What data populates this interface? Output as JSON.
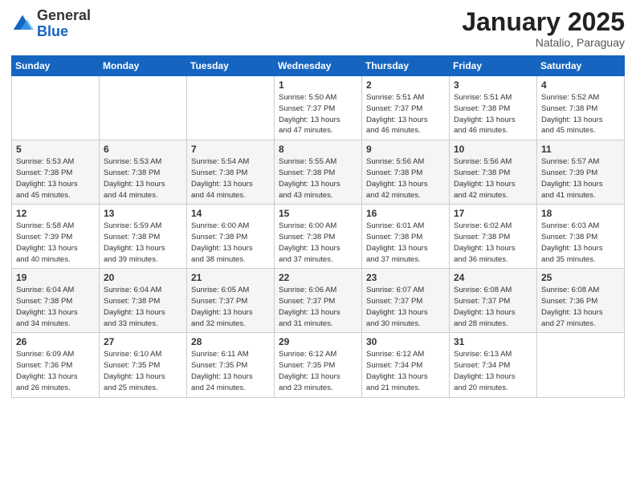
{
  "logo": {
    "general": "General",
    "blue": "Blue"
  },
  "header": {
    "month": "January 2025",
    "location": "Natalio, Paraguay"
  },
  "weekdays": [
    "Sunday",
    "Monday",
    "Tuesday",
    "Wednesday",
    "Thursday",
    "Friday",
    "Saturday"
  ],
  "weeks": [
    [
      {
        "day": "",
        "info": ""
      },
      {
        "day": "",
        "info": ""
      },
      {
        "day": "",
        "info": ""
      },
      {
        "day": "1",
        "info": "Sunrise: 5:50 AM\nSunset: 7:37 PM\nDaylight: 13 hours\nand 47 minutes."
      },
      {
        "day": "2",
        "info": "Sunrise: 5:51 AM\nSunset: 7:37 PM\nDaylight: 13 hours\nand 46 minutes."
      },
      {
        "day": "3",
        "info": "Sunrise: 5:51 AM\nSunset: 7:38 PM\nDaylight: 13 hours\nand 46 minutes."
      },
      {
        "day": "4",
        "info": "Sunrise: 5:52 AM\nSunset: 7:38 PM\nDaylight: 13 hours\nand 45 minutes."
      }
    ],
    [
      {
        "day": "5",
        "info": "Sunrise: 5:53 AM\nSunset: 7:38 PM\nDaylight: 13 hours\nand 45 minutes."
      },
      {
        "day": "6",
        "info": "Sunrise: 5:53 AM\nSunset: 7:38 PM\nDaylight: 13 hours\nand 44 minutes."
      },
      {
        "day": "7",
        "info": "Sunrise: 5:54 AM\nSunset: 7:38 PM\nDaylight: 13 hours\nand 44 minutes."
      },
      {
        "day": "8",
        "info": "Sunrise: 5:55 AM\nSunset: 7:38 PM\nDaylight: 13 hours\nand 43 minutes."
      },
      {
        "day": "9",
        "info": "Sunrise: 5:56 AM\nSunset: 7:38 PM\nDaylight: 13 hours\nand 42 minutes."
      },
      {
        "day": "10",
        "info": "Sunrise: 5:56 AM\nSunset: 7:38 PM\nDaylight: 13 hours\nand 42 minutes."
      },
      {
        "day": "11",
        "info": "Sunrise: 5:57 AM\nSunset: 7:39 PM\nDaylight: 13 hours\nand 41 minutes."
      }
    ],
    [
      {
        "day": "12",
        "info": "Sunrise: 5:58 AM\nSunset: 7:39 PM\nDaylight: 13 hours\nand 40 minutes."
      },
      {
        "day": "13",
        "info": "Sunrise: 5:59 AM\nSunset: 7:38 PM\nDaylight: 13 hours\nand 39 minutes."
      },
      {
        "day": "14",
        "info": "Sunrise: 6:00 AM\nSunset: 7:38 PM\nDaylight: 13 hours\nand 38 minutes."
      },
      {
        "day": "15",
        "info": "Sunrise: 6:00 AM\nSunset: 7:38 PM\nDaylight: 13 hours\nand 37 minutes."
      },
      {
        "day": "16",
        "info": "Sunrise: 6:01 AM\nSunset: 7:38 PM\nDaylight: 13 hours\nand 37 minutes."
      },
      {
        "day": "17",
        "info": "Sunrise: 6:02 AM\nSunset: 7:38 PM\nDaylight: 13 hours\nand 36 minutes."
      },
      {
        "day": "18",
        "info": "Sunrise: 6:03 AM\nSunset: 7:38 PM\nDaylight: 13 hours\nand 35 minutes."
      }
    ],
    [
      {
        "day": "19",
        "info": "Sunrise: 6:04 AM\nSunset: 7:38 PM\nDaylight: 13 hours\nand 34 minutes."
      },
      {
        "day": "20",
        "info": "Sunrise: 6:04 AM\nSunset: 7:38 PM\nDaylight: 13 hours\nand 33 minutes."
      },
      {
        "day": "21",
        "info": "Sunrise: 6:05 AM\nSunset: 7:37 PM\nDaylight: 13 hours\nand 32 minutes."
      },
      {
        "day": "22",
        "info": "Sunrise: 6:06 AM\nSunset: 7:37 PM\nDaylight: 13 hours\nand 31 minutes."
      },
      {
        "day": "23",
        "info": "Sunrise: 6:07 AM\nSunset: 7:37 PM\nDaylight: 13 hours\nand 30 minutes."
      },
      {
        "day": "24",
        "info": "Sunrise: 6:08 AM\nSunset: 7:37 PM\nDaylight: 13 hours\nand 28 minutes."
      },
      {
        "day": "25",
        "info": "Sunrise: 6:08 AM\nSunset: 7:36 PM\nDaylight: 13 hours\nand 27 minutes."
      }
    ],
    [
      {
        "day": "26",
        "info": "Sunrise: 6:09 AM\nSunset: 7:36 PM\nDaylight: 13 hours\nand 26 minutes."
      },
      {
        "day": "27",
        "info": "Sunrise: 6:10 AM\nSunset: 7:35 PM\nDaylight: 13 hours\nand 25 minutes."
      },
      {
        "day": "28",
        "info": "Sunrise: 6:11 AM\nSunset: 7:35 PM\nDaylight: 13 hours\nand 24 minutes."
      },
      {
        "day": "29",
        "info": "Sunrise: 6:12 AM\nSunset: 7:35 PM\nDaylight: 13 hours\nand 23 minutes."
      },
      {
        "day": "30",
        "info": "Sunrise: 6:12 AM\nSunset: 7:34 PM\nDaylight: 13 hours\nand 21 minutes."
      },
      {
        "day": "31",
        "info": "Sunrise: 6:13 AM\nSunset: 7:34 PM\nDaylight: 13 hours\nand 20 minutes."
      },
      {
        "day": "",
        "info": ""
      }
    ]
  ]
}
